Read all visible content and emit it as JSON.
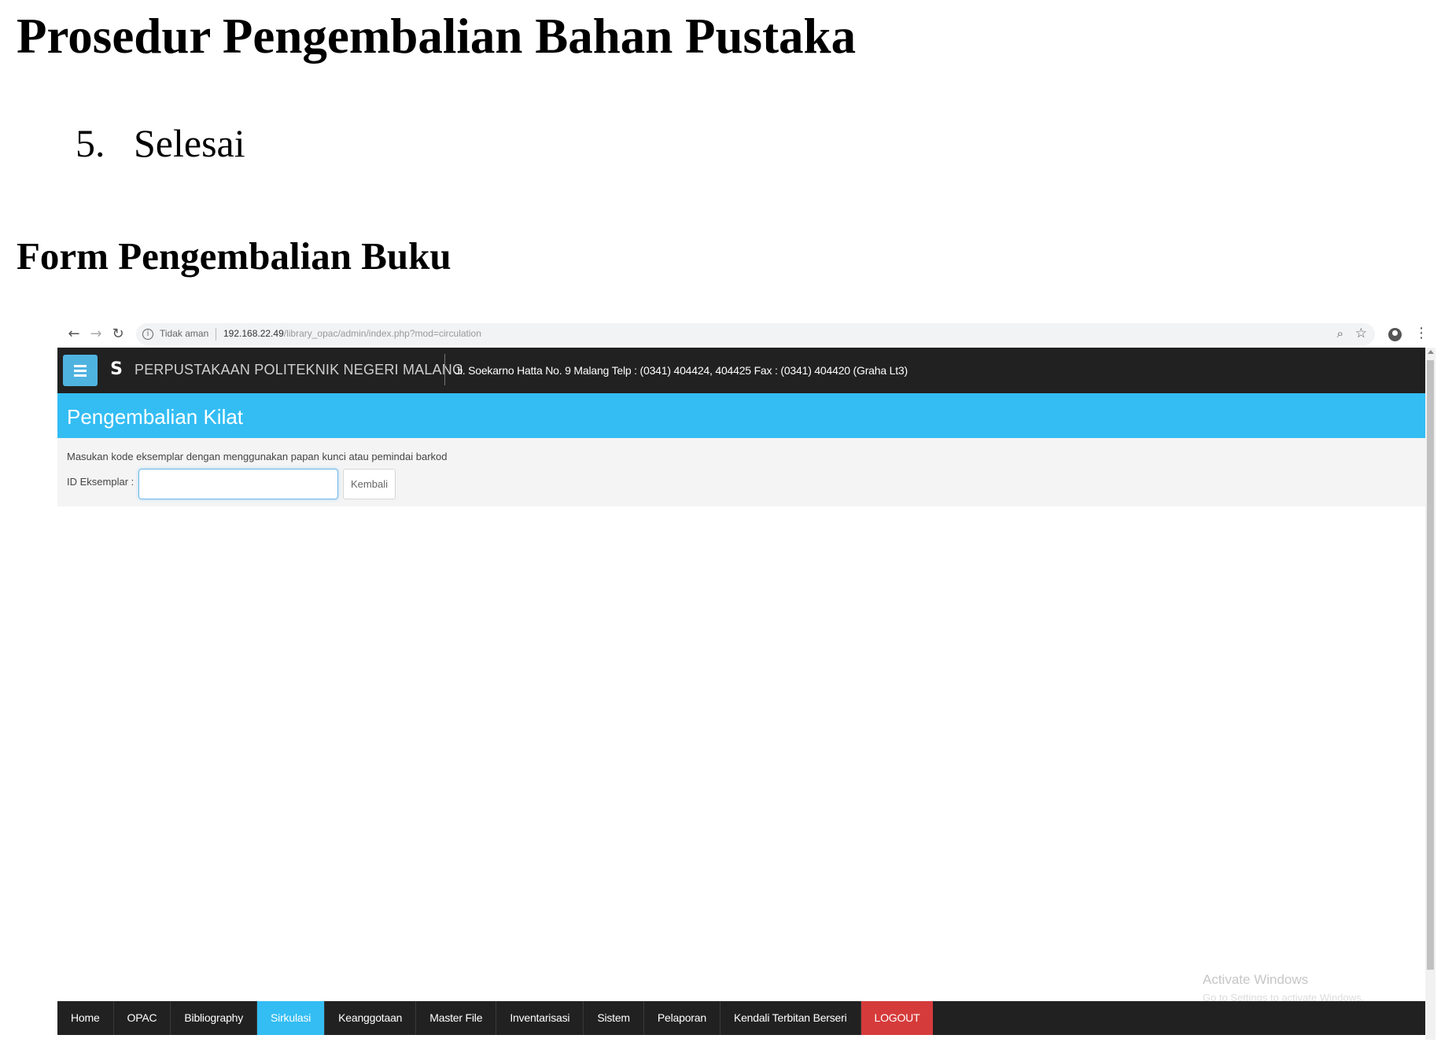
{
  "document": {
    "title": "Prosedur Pengembalian Bahan Pustaka",
    "step_number": "5.",
    "step_text": "Selesai",
    "section_title": "Form Pengembalian Buku"
  },
  "browser": {
    "back_icon": "arrow-left",
    "forward_icon": "arrow-right",
    "reload_icon": "reload",
    "security_text": "Tidak aman",
    "url_host": "192.168.22.49",
    "url_path": "/library_opac/admin/index.php?mod=circulation"
  },
  "app": {
    "name": "PERPUSTAKAAN POLITEKNIK NEGERI MALANG",
    "logo_letter": "S",
    "address": "Jl. Soekarno Hatta No. 9 Malang Telp : (0341) 404424, 404425 Fax : (0341) 404420 (Graha Lt3)"
  },
  "panel": {
    "title": "Pengembalian Kilat",
    "instruction": "Masukan kode eksemplar dengan menggunakan papan kunci atau pemindai barkod",
    "id_label": "ID Eksemplar :",
    "id_value": "",
    "return_button": "Kembali"
  },
  "nav": {
    "items": [
      {
        "label": "Home"
      },
      {
        "label": "OPAC"
      },
      {
        "label": "Bibliography"
      },
      {
        "label": "Sirkulasi",
        "active": true
      },
      {
        "label": "Keanggotaan"
      },
      {
        "label": "Master File"
      },
      {
        "label": "Inventarisasi"
      },
      {
        "label": "Sistem"
      },
      {
        "label": "Pelaporan"
      },
      {
        "label": "Kendali Terbitan Berseri"
      },
      {
        "label": "LOGOUT"
      }
    ]
  },
  "watermark": {
    "title": "Activate Windows",
    "subtitle": "Go to Settings to activate Windows."
  },
  "colors": {
    "header_bg": "#212121",
    "accent_blue": "#33bdf3",
    "logout_red": "#d63b3b"
  }
}
